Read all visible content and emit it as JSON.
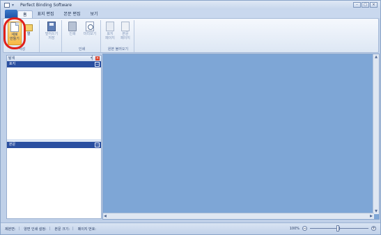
{
  "window": {
    "title": "Perfect Binding Software",
    "controls": [
      "–",
      "□",
      "×"
    ]
  },
  "tabs": [
    {
      "label": "홈",
      "active": true
    },
    {
      "label": "표지 편집",
      "active": false
    },
    {
      "label": "본문 편집",
      "active": false
    },
    {
      "label": "보기",
      "active": false
    }
  ],
  "ribbon": {
    "group1": {
      "label": "작성",
      "new_button": "새로\n만들기",
      "open_button": "열"
    },
    "save_button": "덮어쓰기\n저장",
    "group2": {
      "label": "인쇄",
      "print_button": "인쇄",
      "preview_button": "미리보기"
    },
    "group3": {
      "label": "원본 불러오기",
      "cover_button": "표지\n페이지",
      "body_button": "본문\n페이지"
    }
  },
  "panel": {
    "title": "탐색",
    "pin_glyph": "╡",
    "close_glyph": "×",
    "collapse_glyph": "−",
    "section1": "표지",
    "section2": "본문"
  },
  "statusbar": {
    "items": [
      "제본면:",
      "양면 인쇄 설정:",
      "본문 크기:",
      "페이지 번호:"
    ],
    "separator": "|",
    "zoom": "100%",
    "zoom_out": "−",
    "zoom_in": "+"
  },
  "scroll": {
    "up": "▲",
    "down": "▼",
    "left": "◀",
    "right": "▶"
  },
  "colors": {
    "canvas": "#7ea6d6",
    "section_bar": "#2a4fa0",
    "highlight": "#e0201a"
  }
}
